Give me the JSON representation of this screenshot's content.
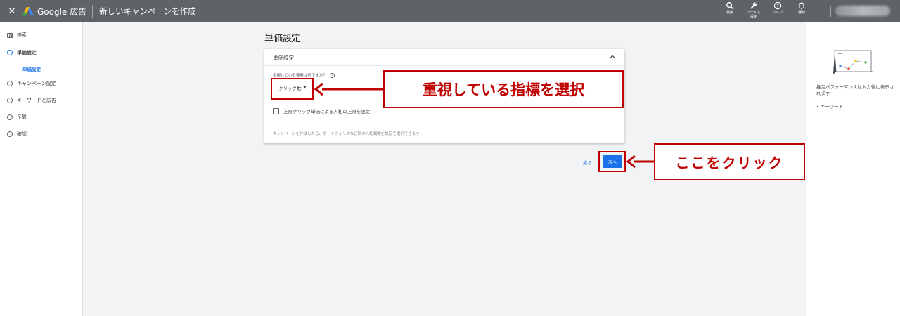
{
  "topbar": {
    "close_glyph": "✕",
    "brand": "Google 広告",
    "page_heading": "新しいキャンペーンを作成",
    "icons": [
      {
        "name": "search-icon",
        "label": "検索"
      },
      {
        "name": "wrench-icon",
        "label": "ツールと\n設定"
      },
      {
        "name": "help-icon",
        "label": "ヘルプ"
      },
      {
        "name": "bell-icon",
        "label": "通知"
      }
    ]
  },
  "sidebar": {
    "items": [
      {
        "label": "検索",
        "icon": "search-box-icon"
      },
      {
        "label": "単価設定",
        "icon": "step-circle-icon",
        "active": true
      },
      {
        "label": "キャンペーン設定",
        "icon": "step-circle-icon"
      },
      {
        "label": "キーワードと広告",
        "icon": "step-circle-icon"
      },
      {
        "label": "予算",
        "icon": "step-circle-icon"
      },
      {
        "label": "確認",
        "icon": "step-circle-icon"
      }
    ],
    "sub_item": "単価設定"
  },
  "main": {
    "title": "単価設定",
    "card": {
      "title": "単価設定",
      "question": "重視している要素は何ですか？",
      "help_glyph": "?",
      "dropdown_value": "クリック数",
      "dropdown_caret": "▼",
      "checkbox_label": "上限クリック単価による入札の上限を設定",
      "footer": "キャンペーンを作成したら、ポートフォリオなど別の入札戦略を設定で選択できます"
    },
    "back_label": "戻る",
    "next_label": "次へ"
  },
  "right_panel": {
    "text": "推定パフォーマンスは入力後に表示されます",
    "bullet": "•  キーワード"
  },
  "annotations": {
    "callout_metric": "重視している指標を選択",
    "callout_click": "ここをクリック",
    "color": "#c00000"
  },
  "colors": {
    "topbar": "#5f6368",
    "accent": "#1a73e8",
    "annotation": "#c00000"
  }
}
